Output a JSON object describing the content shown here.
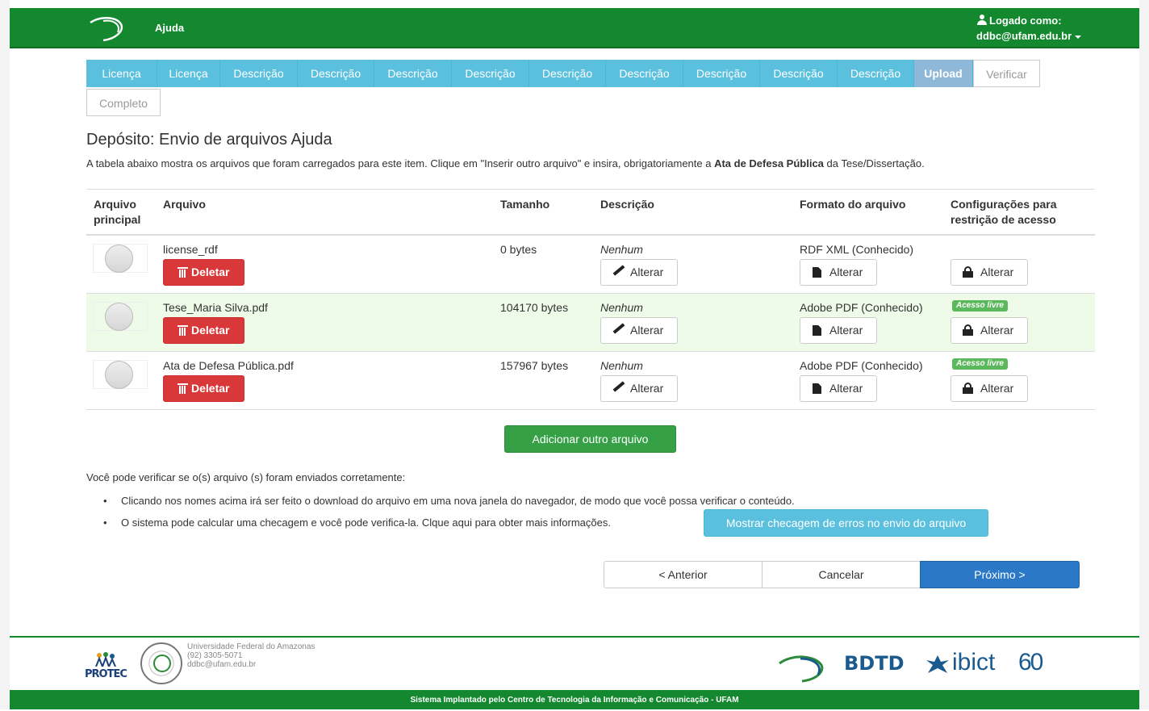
{
  "header": {
    "title": "Ajuda",
    "user_label": "Logado como:",
    "user_email": "ddbc@ufam.edu.br"
  },
  "steps": [
    {
      "label": "Licença",
      "state": "done"
    },
    {
      "label": "Licença",
      "state": "done"
    },
    {
      "label": "Descrição",
      "state": "done"
    },
    {
      "label": "Descrição",
      "state": "done"
    },
    {
      "label": "Descrição",
      "state": "done"
    },
    {
      "label": "Descrição",
      "state": "done"
    },
    {
      "label": "Descrição",
      "state": "done"
    },
    {
      "label": "Descrição",
      "state": "done"
    },
    {
      "label": "Descrição",
      "state": "done"
    },
    {
      "label": "Descrição",
      "state": "done"
    },
    {
      "label": "Descrição",
      "state": "done"
    },
    {
      "label": "Upload",
      "state": "active"
    },
    {
      "label": "Verificar",
      "state": "todo"
    },
    {
      "label": "Completo",
      "state": "todo"
    }
  ],
  "page": {
    "heading": "Depósito: Envio de arquivos Ajuda",
    "intro_before": "A tabela abaixo mostra os arquivos que foram carregados para este item. Clique em \"Inserir outro arquivo\" e insira, obrigatoriamente a ",
    "intro_bold": "Ata de Defesa Pública",
    "intro_after": " da Tese/Dissertação."
  },
  "table": {
    "headers": {
      "primary_1": "Arquivo",
      "primary_2": "principal",
      "file": "Arquivo",
      "size": "Tamanho",
      "description": "Descrição",
      "format": "Formato do arquivo",
      "access_1": "Configurações para",
      "access_2": "restrição de acesso"
    },
    "rows": [
      {
        "name": "license_rdf",
        "size": "0 bytes",
        "description": "Nenhum",
        "format": "RDF XML (Conhecido)",
        "badge": ""
      },
      {
        "name": "Tese_Maria Silva.pdf",
        "size": "104170 bytes",
        "description": "Nenhum",
        "format": "Adobe PDF (Conhecido)",
        "badge": "Acesso livre"
      },
      {
        "name": "Ata de Defesa Pública.pdf",
        "size": "157967 bytes",
        "description": "Nenhum",
        "format": "Adobe PDF (Conhecido)",
        "badge": "Acesso livre"
      }
    ],
    "delete_label": "Deletar",
    "change_label": "Alterar"
  },
  "actions": {
    "add_file": "Adicionar outro arquivo",
    "verify_intro": "Você pode verificar se o(s) arquivo (s) foram enviados corretamente:",
    "bullet_1": "Clicando nos nomes acima irá ser feito o download do arquivo em uma nova janela do navegador, de modo que você possa verificar o conteúdo.",
    "bullet_2": "O sistema pode calcular uma checagem e você pode verifica-la. Clque aqui para obter mais informações.",
    "show_checksum": "Mostrar checagem de erros no envio do arquivo",
    "prev": "< Anterior",
    "cancel": "Cancelar",
    "next": "Próximo >"
  },
  "footer": {
    "protec": "PROTEC",
    "university": "Universidade Federal do Amazonas",
    "phone": "(92) 3305-5071",
    "email": "ddbc@ufam.edu.br",
    "bdtd": "BDTD",
    "ibict": "ibict",
    "ibict_years": "60",
    "bottom": "Sistema Implantado pelo Centro de Tecnologia da Informação e Comunicação - UFAM"
  },
  "colors": {
    "brand_green": "#13882f",
    "step_done": "#5bc0de",
    "delete_red": "#d9383a",
    "next_blue": "#2a78c6"
  }
}
